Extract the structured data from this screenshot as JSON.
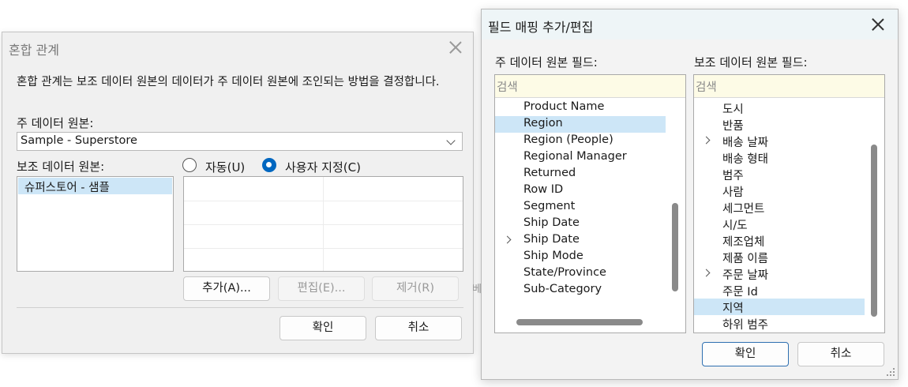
{
  "blend_dialog": {
    "title": "혼합 관계",
    "description": "혼합 관계는 보조 데이터 원본의 데이터가 주 데이터 원본에 조인되는 방법을 결정합니다.",
    "primary_label": "주 데이터 원본:",
    "primary_value": "Sample - Superstore",
    "secondary_label": "보조 데이터 원본:",
    "secondary_items": [
      "슈퍼스토어 - 샘플"
    ],
    "radio_auto": "자동(U)",
    "radio_custom": "사용자 지정(C)",
    "radio_selected": "custom",
    "btn_add": "추가(A)...",
    "btn_edit": "편집(E)...",
    "btn_remove": "제거(R)",
    "btn_ok": "확인",
    "btn_cancel": "취소"
  },
  "map_dialog": {
    "title": "필드 매핑 추가/편집",
    "primary_label": "주 데이터 원본 필드:",
    "secondary_label": "보조 데이터 원본 필드:",
    "search_placeholder": "검색",
    "primary_fields": [
      {
        "label": "Product Name",
        "expandable": false,
        "selected": false
      },
      {
        "label": "Region",
        "expandable": false,
        "selected": true
      },
      {
        "label": "Region (People)",
        "expandable": false,
        "selected": false
      },
      {
        "label": "Regional Manager",
        "expandable": false,
        "selected": false
      },
      {
        "label": "Returned",
        "expandable": false,
        "selected": false
      },
      {
        "label": "Row ID",
        "expandable": false,
        "selected": false
      },
      {
        "label": "Segment",
        "expandable": false,
        "selected": false
      },
      {
        "label": "Ship Date",
        "expandable": false,
        "selected": false
      },
      {
        "label": "Ship Date",
        "expandable": true,
        "selected": false
      },
      {
        "label": "Ship Mode",
        "expandable": false,
        "selected": false
      },
      {
        "label": "State/Province",
        "expandable": false,
        "selected": false
      },
      {
        "label": "Sub-Category",
        "expandable": false,
        "selected": false
      }
    ],
    "secondary_fields": [
      {
        "label": "도시",
        "expandable": false,
        "selected": false
      },
      {
        "label": "반품",
        "expandable": false,
        "selected": false
      },
      {
        "label": "배송 날짜",
        "expandable": true,
        "selected": false
      },
      {
        "label": "배송 형태",
        "expandable": false,
        "selected": false
      },
      {
        "label": "범주",
        "expandable": false,
        "selected": false
      },
      {
        "label": "사람",
        "expandable": false,
        "selected": false
      },
      {
        "label": "세그먼트",
        "expandable": false,
        "selected": false
      },
      {
        "label": "시/도",
        "expandable": false,
        "selected": false
      },
      {
        "label": "제조업체",
        "expandable": false,
        "selected": false
      },
      {
        "label": "제품 이름",
        "expandable": false,
        "selected": false
      },
      {
        "label": "주문 날짜",
        "expandable": true,
        "selected": false
      },
      {
        "label": "주문 Id",
        "expandable": false,
        "selected": false
      },
      {
        "label": "지역",
        "expandable": false,
        "selected": true
      },
      {
        "label": "하위 범주",
        "expandable": false,
        "selected": false
      }
    ],
    "btn_ok": "확인",
    "btn_cancel": "취소"
  },
  "stray_text": "베"
}
